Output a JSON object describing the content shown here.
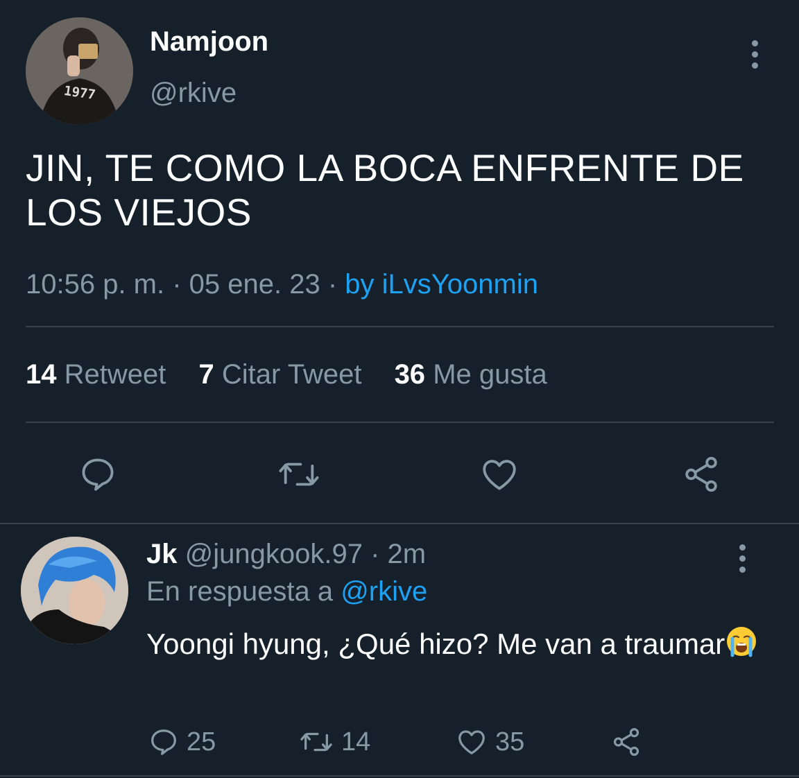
{
  "tweet": {
    "author_name": "Namjoon",
    "author_handle": "@rkive",
    "avatar_shirt_text": "1977",
    "text": "JIN, TE COMO LA BOCA ENFRENTE DE LOS VIEJOS",
    "time": "10:56 p. m.",
    "sep1": " · ",
    "date": "05 ene. 23",
    "sep2": " · ",
    "source": "by iLvsYoonmin",
    "stats": {
      "retweets_count": "14",
      "retweets_label": "Retweet",
      "quotes_count": "7",
      "quotes_label": "Citar Tweet",
      "likes_count": "36",
      "likes_label": "Me gusta"
    },
    "actions": [
      "reply-icon",
      "retweet-icon",
      "like-icon",
      "share-icon"
    ]
  },
  "reply": {
    "author_name": "Jk",
    "author_handle": "@jungkook.97",
    "time": " · 2m",
    "replying_label": "En respuesta a ",
    "replying_to": "@rkive",
    "text": "Yoongi hyung, ¿Qué hizo? Me van a traumar",
    "emoji": "loudly-crying-face",
    "counts": {
      "replies": "25",
      "retweets": "14",
      "likes": "35"
    }
  },
  "colors": {
    "background": "#15202b",
    "text": "#ffffff",
    "secondary": "#8899a6",
    "link": "#1da1f2",
    "divider": "#38444d"
  }
}
